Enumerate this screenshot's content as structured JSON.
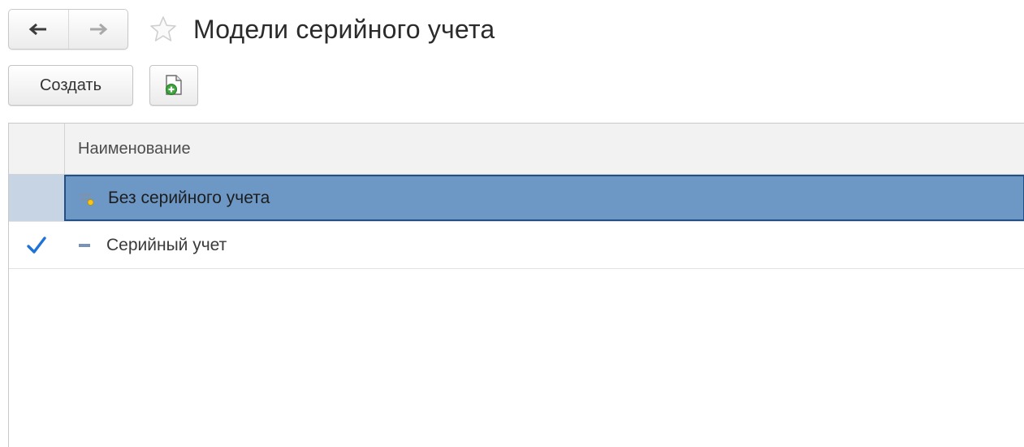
{
  "window": {
    "title": "Модели серийного учета"
  },
  "navigation": {
    "back_icon": "arrow-left-icon",
    "forward_icon": "arrow-right-icon",
    "favorite_icon": "star-outline-icon"
  },
  "toolbar": {
    "create_label": "Создать",
    "copy_icon": "new-document-plus-icon"
  },
  "table": {
    "columns": [
      "Наименование"
    ],
    "rows": [
      {
        "name": "Без серийного учета",
        "icon": "predefined-item-marked-icon",
        "checked": false,
        "selected": true
      },
      {
        "name": "Серийный учет",
        "icon": "predefined-item-icon",
        "checked": true,
        "selected": false
      }
    ]
  },
  "colors": {
    "selection_fill": "#6d98c6",
    "selection_border": "#214f86",
    "check_mark": "#1f73d8"
  }
}
